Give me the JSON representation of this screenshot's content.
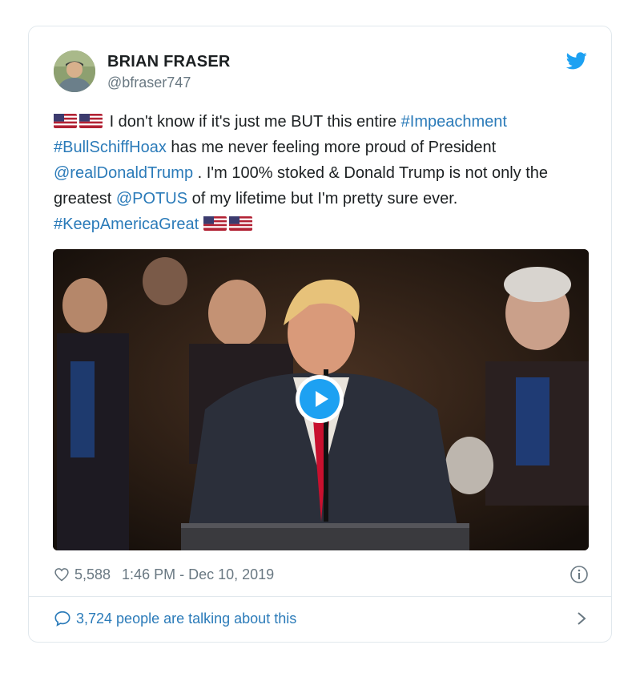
{
  "tweet": {
    "author": {
      "name": "BRIAN FRASER",
      "handle": "@bfraser747"
    },
    "body": {
      "intro": "I don't know if it's just me BUT this entire",
      "hashtag_impeachment": "#Impeachment",
      "hashtag_hoax": "#BullSchiffHoax",
      "text_proud": "has me never feeling more proud of President",
      "mention_trump": "@realDonaldTrump",
      "text_stoked": ". I'm 100% stoked & Donald Trump is not only the greatest",
      "mention_potus": "@POTUS",
      "text_lifetime": "of my lifetime but I'm pretty sure ever.",
      "hashtag_kag": "#KeepAmericaGreat"
    },
    "flags": [
      "us-flag-icon",
      "us-flag-icon"
    ],
    "media": {
      "type": "video",
      "play_icon": "play-icon"
    },
    "likes": "5,588",
    "timestamp": "1:46 PM - Dec 10, 2019",
    "conversation": "3,724 people are talking about this"
  },
  "colors": {
    "link": "#2b7bb9",
    "twitter_blue": "#1da1f2",
    "muted": "#697882",
    "border": "#e1e8ed"
  },
  "icons": {
    "brand": "twitter-bird-icon",
    "like": "heart-icon",
    "info": "info-icon",
    "reply": "speech-bubble-icon",
    "more": "chevron-right-icon"
  }
}
